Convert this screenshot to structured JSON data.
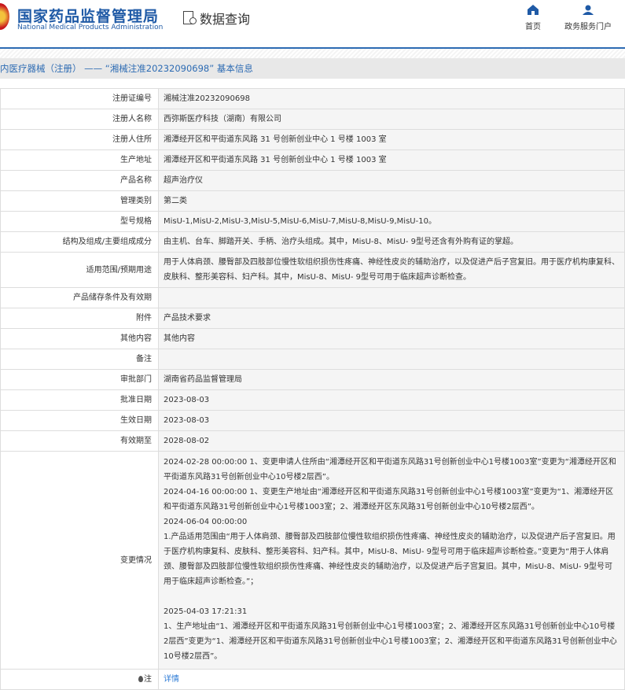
{
  "header": {
    "org_cn": "国家药品监督管理局",
    "org_en": "National Medical Products Administration",
    "section": "数据查询",
    "nav": [
      {
        "label": "首页"
      },
      {
        "label": "政务服务门户"
      }
    ]
  },
  "title": "内医疗器械（注册） —— “湘械注准20232090698” 基本信息",
  "rows": [
    {
      "label": "注册证编号",
      "value": "湘械注准20232090698"
    },
    {
      "label": "注册人名称",
      "value": "西弥斯医疗科技（湖南）有限公司"
    },
    {
      "label": "注册人住所",
      "value": "湘潭经开区和平街道东风路 31 号创新创业中心 1 号楼 1003 室"
    },
    {
      "label": "生产地址",
      "value": "湘潭经开区和平街道东风路 31 号创新创业中心 1 号楼 1003 室"
    },
    {
      "label": "产品名称",
      "value": "超声治疗仪"
    },
    {
      "label": "管理类别",
      "value": "第二类"
    },
    {
      "label": "型号规格",
      "value": "MisU-1,MisU-2,MisU-3,MisU-5,MisU-6,MisU-7,MisU-8,MisU-9,MisU-10。"
    },
    {
      "label": "结构及组成/主要组成成分",
      "value": "由主机、台车、脚踏开关、手柄、治疗头组成。其中，MisU-8、MisU- 9型号还含有外购有证的掌超。"
    },
    {
      "label": "适用范围/预期用途",
      "value": "用于人体肩颈、腰臀部及四肢部位慢性软组织损伤性疼痛、神经性皮炎的辅助治疗，以及促进产后子宫复旧。用于医疗机构康复科、皮肤科、整形美容科、妇产科。其中，MisU-8、MisU- 9型号可用于临床超声诊断检查。"
    },
    {
      "label": "产品储存条件及有效期",
      "value": ""
    },
    {
      "label": "附件",
      "value": "产品技术要求"
    },
    {
      "label": "其他内容",
      "value": "其他内容"
    },
    {
      "label": "备注",
      "value": ""
    },
    {
      "label": "审批部门",
      "value": "湖南省药品监督管理局"
    },
    {
      "label": "批准日期",
      "value": "2023-08-03"
    },
    {
      "label": "生效日期",
      "value": "2023-08-03"
    },
    {
      "label": "有效期至",
      "value": "2028-08-02"
    }
  ],
  "changes": {
    "label": "变更情况",
    "lines": [
      "2024-02-28 00:00:00 1、变更申请人住所由“湘潭经开区和平街道东风路31号创新创业中心1号楼1003室”变更为“湘潭经开区和平街道东风路31号创新创业中心10号楼2层西”。",
      "2024-04-16 00:00:00 1、变更生产地址由“湘潭经开区和平街道东风路31号创新创业中心1号楼1003室”变更为“1、湘潭经开区和平街道东风路31号创新创业中心1号楼1003室；2、湘潭经开区东风路31号创新创业中心10号楼2层西”。",
      "2024-06-04 00:00:00",
      "1.产品适用范围由“用于人体肩颈、腰臀部及四肢部位慢性软组织损伤性疼痛、神经性皮炎的辅助治疗，以及促进产后子宫复旧。用于医疗机构康复科、皮肤科、整形美容科、妇产科。其中，MisU-8、MisU- 9型号可用于临床超声诊断检查。”变更为“用于人体肩颈、腰臀部及四肢部位慢性软组织损伤性疼痛、神经性皮炎的辅助治疗，以及促进产后子宫复旧。其中，MisU-8、MisU- 9型号可用于临床超声诊断检查。”；",
      "",
      "2025-04-03 17:21:31",
      "1、生产地址由“1、湘潭经开区和平街道东风路31号创新创业中心1号楼1003室；2、湘潭经开区东风路31号创新创业中心10号楼2层西”变更为“1、湘潭经开区和平街道东风路31号创新创业中心1号楼1003室；2、湘潭经开区和平街道东风路31号创新创业中心10号楼2层西”。"
    ]
  },
  "note": {
    "label": "注",
    "link": "详情"
  }
}
